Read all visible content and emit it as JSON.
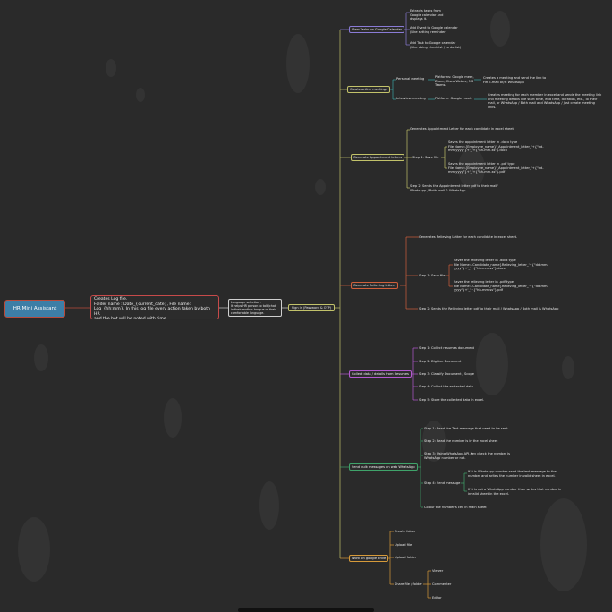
{
  "root": "HR Mini Assistant",
  "log": "Creates Log file.\nFolder name : Date_{current_date}, File name:\nLog_{hh:mm}. In this log file every action taken by both HR\nand the bot will be noted with time.",
  "language": "Language selection :\nIt helps HR person to talk/chat\nin their mother tongue or their\ncomfortable language.",
  "sign_in": "Sign In (Password & OTP)",
  "branches": {
    "view_tasks": {
      "label": "View Tasks on Google Calendar",
      "items": [
        "Extracts tasks from\nGoogle calendar and\ndisplays it.",
        "Add Event to Google calendar\n(Like setting reminder)",
        "Add Task to Google calendar\n(Like doing checklist / to do list)"
      ]
    },
    "create_meetings": {
      "label": "Create online meetings",
      "personal": "Personal meeting",
      "personal_platforms": "Platforms: Google meet,\nZoom, Cisco Webex, MS\nTeams.",
      "personal_result": "Creates a meeting and send the link to\nHR E-mail or/& WhatsApp",
      "interview": "Interview meeting",
      "interview_platform": "Platform: Google meet.",
      "interview_result": "Creates meeting for each member in excel and sends the meeting link\nand meeting details like start time, end time, duration, etc., To their\nmail, or WhatsApp / Both mail and WhatsApp / Just create meeting\nlinks."
    },
    "appointment": {
      "label": "Generate Appointment letters",
      "intro": "Generates Appointment Letter for each candidate in excel sheet.",
      "step1": "Step 1: Save file",
      "docx": "Saves the appointment letter in .docx type\nFile Name:{Employee_name}'_Appointment_letter_'+{\"dd-\nmm-yyyy\"}+'_'+{\"hh-mm-ss\"}.docx",
      "pdf": "Saves the appointment letter in .pdf type\nFile Name:{Employee_name}'_Appointment_letter_'+{\"dd-\nmm-yyyy\"}+'_'+{\"hh-mm-ss\"}.pdf",
      "step2": "Step 2: Sends the Appointment letter pdf to their mail/\nWhatsApp / Both mail & WhatsApp"
    },
    "relieving": {
      "label": "Generate Relieving letters",
      "intro": "Generates Relieving Letter for each candidate in excel sheet.",
      "step1": "Step 1: Save file",
      "docx": "Saves the relieving letter in .docx type\nFile Name:{Candidate_name}Relieving_letter_'+{\"dd-mm-\nyyyy\"}+'_'+{\"hh-mm-ss\"}.docx",
      "pdf": "Saves the relieving letter in .pdf type\nFile Name:{Candidate_name}Relieving_letter_'+{\"dd-mm-\nyyyy\"}+'_'+{\"hh-mm-ss\"}.pdf",
      "step2": "Step 2: Sends the Relieving letter pdf to their mail / WhatsApp / Both mail & WhatsApp"
    },
    "collect": {
      "label": "Collect data / details from Resumes",
      "steps": [
        "Step 1: Collect resumes document",
        "Step 2: Digitize Document",
        "Step 3: Classify Document / Scope",
        "Step 4: Collect the extracted data",
        "Step 5: Store the collected data in excel."
      ]
    },
    "bulk": {
      "label": "Send bulk messages on web WhatsApp",
      "step1": "Step 1: Read the Text message that need to be sent",
      "step2": "Step 2: Read the number is in the excel sheet",
      "step3": "Step 3: Using WhatsApp API-Key check the number is\nWhatsApp number or not.",
      "step4": "Step 4: Send message",
      "yes": "If it is WhatsApp number send the text message to the\nnumber and writes the number in valid sheet in excel.",
      "no": "If it is not a WhatsApp number then writes that number in\ninvalid sheet in the excel.",
      "final": "Colour the number's cell in main sheet"
    },
    "drive": {
      "label": "Work on google drive",
      "items": [
        "Create folder",
        "Upload file",
        "Upload folder",
        "Share file / folder"
      ],
      "roles": [
        "Viewer",
        "Commenter",
        "Editor"
      ]
    }
  }
}
